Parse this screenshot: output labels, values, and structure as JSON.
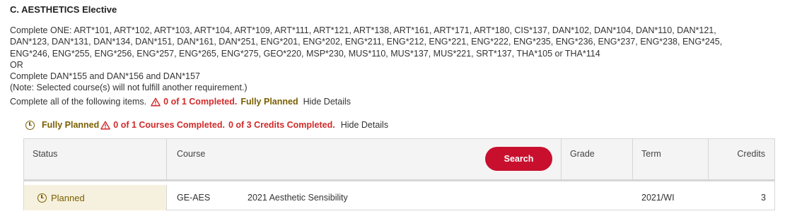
{
  "section": {
    "title": "C. AESTHETICS Elective",
    "lines": [
      "Complete ONE: ART*101, ART*102, ART*103, ART*104, ART*109, ART*111, ART*121, ART*138, ART*161, ART*171, ART*180, CIS*137, DAN*102, DAN*104, DAN*110, DAN*121,",
      "DAN*123, DAN*131, DAN*134, DAN*151, DAN*161, DAN*251, ENG*201, ENG*202, ENG*211, ENG*212, ENG*221, ENG*222, ENG*235, ENG*236, ENG*237, ENG*238, ENG*245,",
      "ENG*246, ENG*255, ENG*256, ENG*257, ENG*265, ENG*275, GEO*220, MSP*230, MUS*110, MUS*137, MUS*221, SRT*137, THA*105 or THA*114",
      "OR",
      "Complete DAN*155 and DAN*156 and DAN*157",
      "(Note: Selected course(s) will not fulfill another requirement.)"
    ]
  },
  "summary": {
    "prefix": "Complete all of the following items.",
    "completed": "0 of 1 Completed.",
    "planned": "Fully Planned",
    "toggle": "Hide Details"
  },
  "subrequirement": {
    "planned": "Fully Planned",
    "courses_completed": "0 of 1 Courses Completed.",
    "credits_completed": "0 of 3 Credits Completed.",
    "toggle": "Hide Details"
  },
  "table": {
    "headers": {
      "status": "Status",
      "course": "Course",
      "search_button": "Search",
      "grade": "Grade",
      "term": "Term",
      "credits": "Credits"
    },
    "rows": [
      {
        "status": "Planned",
        "course_code": "GE-AES",
        "course_title": "2021 Aesthetic Sensibility",
        "grade": "",
        "term": "2021/WI",
        "credits": "3"
      }
    ]
  },
  "colors": {
    "accent_red": "#c8102e",
    "warning_red": "#d12a2a",
    "planned_gold": "#7a5f00",
    "planned_bg": "#f6f1de"
  },
  "icons": {
    "warning": "warning-triangle-icon",
    "planned": "clock-icon"
  }
}
